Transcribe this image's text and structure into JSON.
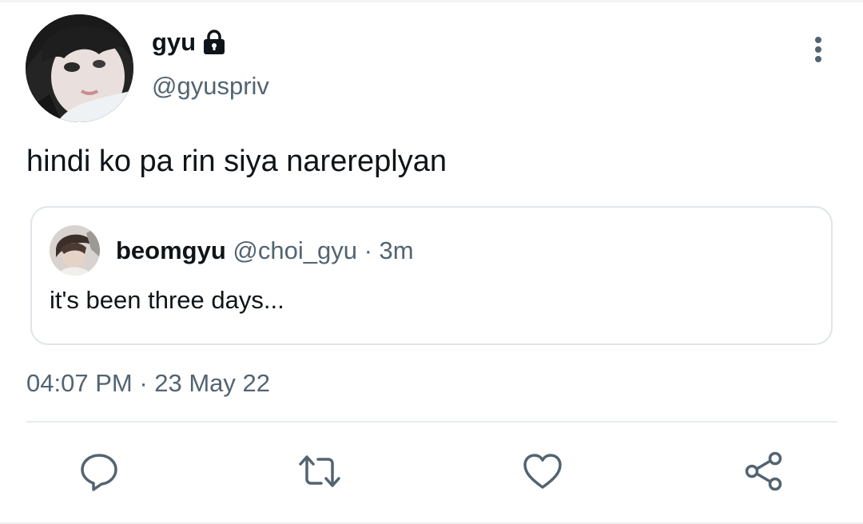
{
  "tweet": {
    "author": {
      "display_name": "gyu",
      "handle": "@gyuspriv",
      "protected": true
    },
    "text": "hindi ko pa rin siya narereplyan",
    "quoted": {
      "display_name": "beomgyu",
      "handle": "@choi_gyu",
      "separator": " · ",
      "time_ago": "3m",
      "text": "it's been three days..."
    },
    "time": "04:07 PM",
    "separator": " · ",
    "date": "23 May 22"
  },
  "icons": {
    "lock": "lock-icon",
    "more": "more-vertical-icon",
    "reply": "reply-bubble-icon",
    "retweet": "retweet-icon",
    "like": "heart-icon",
    "share": "share-icon"
  },
  "colors": {
    "primary_text": "#0f1419",
    "secondary_text": "#536471",
    "border": "#dfe5ea",
    "icon": "#536471"
  }
}
